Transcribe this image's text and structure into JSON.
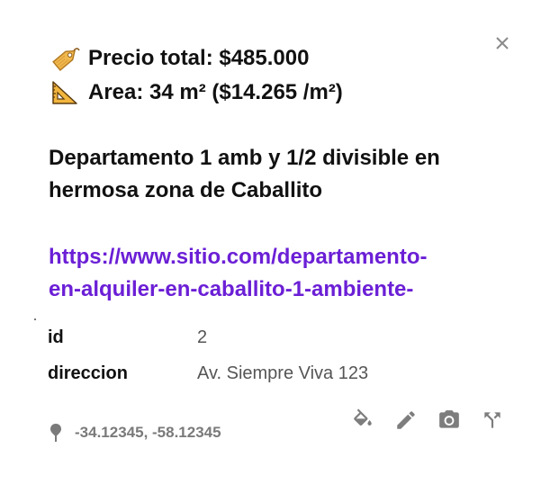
{
  "popup": {
    "price_label": "Precio total: $485.000",
    "area_label": "Area: 34 m² ($14.265 /m²)",
    "title": "Departamento 1 amb y 1/2 divisible en hermosa zona de Caballito",
    "link_line1": "https://www.sitio.com/departamento-",
    "link_line2": "en-alquiler-en-caballito-1-ambiente-",
    "attributes": [
      {
        "key": "id",
        "value": "2"
      },
      {
        "key": "direccion",
        "value": "Av. Siempre Viva 123"
      }
    ],
    "coordinates": "-34.12345, -58.12345",
    "icons": {
      "close": "close-icon",
      "price": "price-tag-icon",
      "area": "triangular-ruler-icon",
      "location": "location-pin-icon",
      "fill": "paint-bucket-icon",
      "edit": "pencil-icon",
      "photo": "camera-icon",
      "route": "directions-icon"
    },
    "colors": {
      "link": "#6b1fd6",
      "text": "#111111",
      "muted": "#7a7a7a",
      "icon": "#7d7d7d"
    }
  }
}
